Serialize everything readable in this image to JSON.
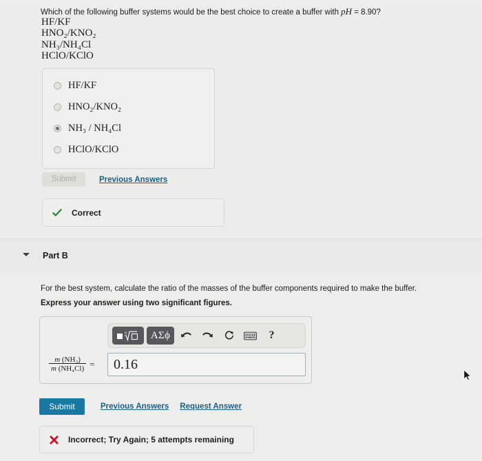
{
  "part_a": {
    "prompt_prefix": "Which of the following buffer systems would be the best choice to create a buffer with ",
    "prompt_ph": "pH",
    "prompt_value": " = 8.90?",
    "formulas": [
      "HF/KF",
      "HNO₂/KNO₂",
      "NH₃/NH₄Cl",
      "HClO/KClO"
    ],
    "options": [
      {
        "label": "HF/KF",
        "selected": false
      },
      {
        "label": "HNO₂/KNO₂",
        "selected": false
      },
      {
        "label": "NH₃ / NH₄Cl",
        "selected": true
      },
      {
        "label": "HClO/KClO",
        "selected": false
      }
    ],
    "submit_label": "Submit",
    "previous_answers_label": "Previous Answers",
    "feedback": {
      "text": "Correct",
      "icon": "check-icon",
      "color": "#1f8a3b"
    }
  },
  "part_b": {
    "title": "Part B",
    "question": "For the best system, calculate the ratio of the masses of the buffer components required to make the buffer.",
    "instruction": "Express your answer using two significant figures.",
    "toolbar": {
      "template_label": "math-template",
      "greek_label": "ΑΣϕ",
      "undo_label": "undo",
      "redo_label": "redo",
      "reset_label": "reset",
      "keyboard_label": "keyboard",
      "help_label": "?"
    },
    "ratio_label": {
      "numerator_m": "m",
      "numerator_species": "(NH₃)",
      "denominator_m": "m",
      "denominator_species": "(NH₄Cl)",
      "equals": "="
    },
    "answer_value": "0.16",
    "answer_placeholder": "",
    "submit_label": "Submit",
    "previous_answers_label": "Previous Answers",
    "request_answer_label": "Request Answer",
    "feedback": {
      "text": "Incorrect; Try Again; 5 attempts remaining",
      "icon": "x-icon",
      "color": "#c8102e"
    }
  },
  "colors": {
    "page_background": "#ececeb",
    "primary_button": "#1a78a4",
    "link": "#1c5f86",
    "correct": "#1f8a3b",
    "incorrect": "#c8102e",
    "toolbar_dark": "#56585b"
  }
}
